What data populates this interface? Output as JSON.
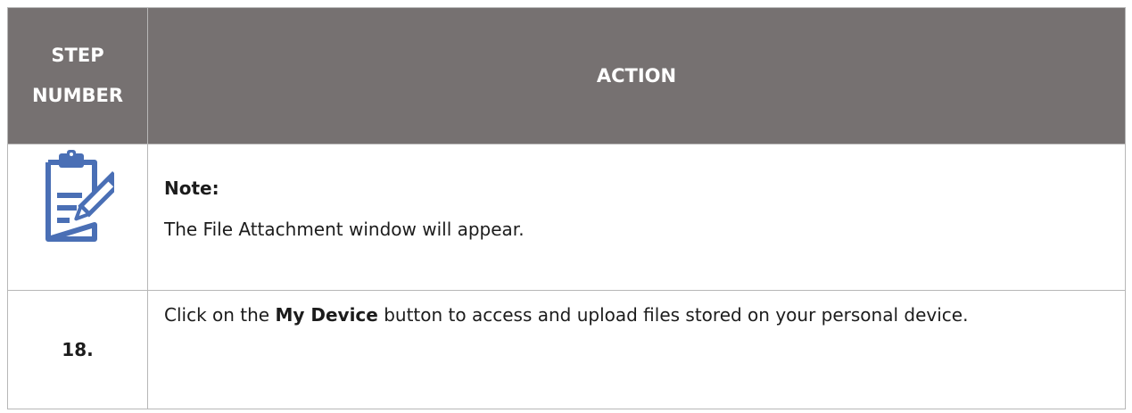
{
  "table": {
    "header": {
      "step_line1": "STEP",
      "step_line2": "NUMBER",
      "action": "ACTION"
    },
    "note": {
      "icon": "clipboard-edit-icon",
      "title": "Note:",
      "text": "The File Attachment window will appear."
    },
    "step": {
      "number": "18.",
      "text_before": "Click on the ",
      "bold_text": "My Device",
      "text_after": " button to access and upload files stored on your personal device."
    }
  },
  "colors": {
    "header_bg": "#767171",
    "header_text": "#ffffff",
    "icon_color": "#4a6fb5",
    "border": "#b7b7b7"
  }
}
